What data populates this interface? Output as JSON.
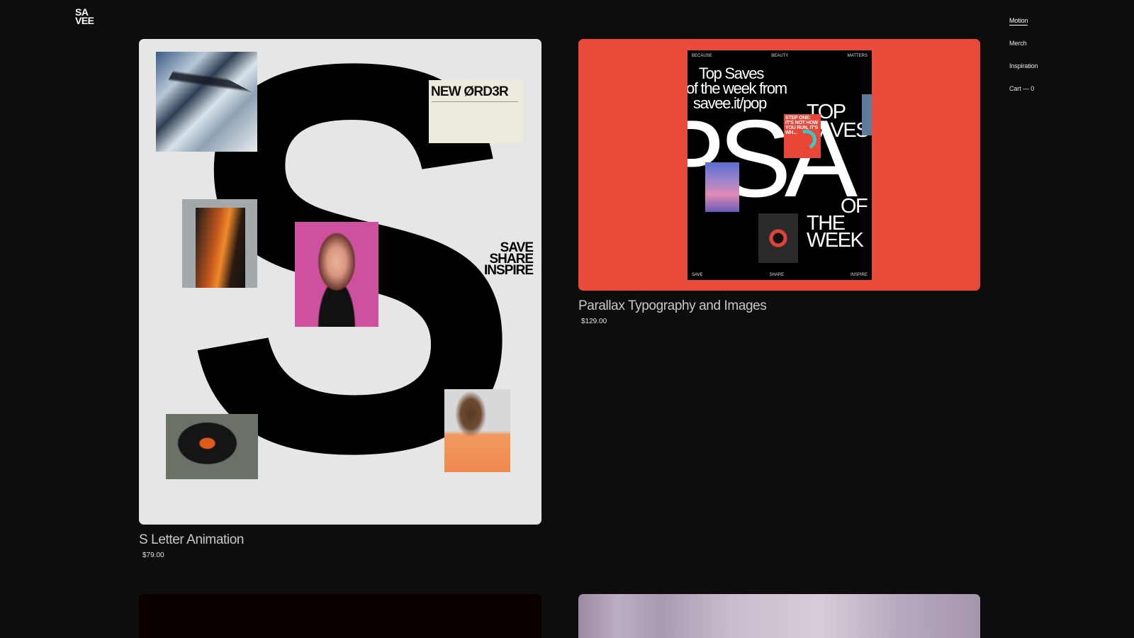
{
  "brand": {
    "line1": "SA",
    "line2": "VEE"
  },
  "nav": {
    "items": [
      {
        "label": "Motion",
        "active": true
      },
      {
        "label": "Merch",
        "active": false
      },
      {
        "label": "Inspiration",
        "active": false
      },
      {
        "label": "Cart — 0",
        "active": false
      }
    ]
  },
  "products": [
    {
      "title": "S Letter Animation",
      "price": "$79.00",
      "artwork": {
        "big_letter": "S",
        "new_order_text": "NEW ØRD3R",
        "tagline": [
          "SAVE",
          "SHARE",
          "INSPIRE"
        ]
      }
    },
    {
      "title": "Parallax Typography and Images",
      "price": "$129.00",
      "artwork": {
        "top_labels": [
          "BECAUSE",
          "BEAUTY",
          "MATTERS"
        ],
        "headline": [
          "Top Saves",
          "of the week from",
          "savee.it/pop"
        ],
        "big_text": "PSA",
        "top_saves": [
          "TOP",
          "SAVES"
        ],
        "of_the_week": [
          "OF",
          "THE",
          "WEEK"
        ],
        "step_text": [
          "STEP ONE:",
          "IT'S NOT HOW",
          "YOU RUN, IT'S",
          "WH..."
        ],
        "bottom_labels": [
          "SAVE",
          "SHARE",
          "INSPIRE"
        ]
      }
    }
  ],
  "colors": {
    "background": "#0d0d0d",
    "card1_bg": "#e6e6e6",
    "card2_bg": "#ea4a3a"
  }
}
